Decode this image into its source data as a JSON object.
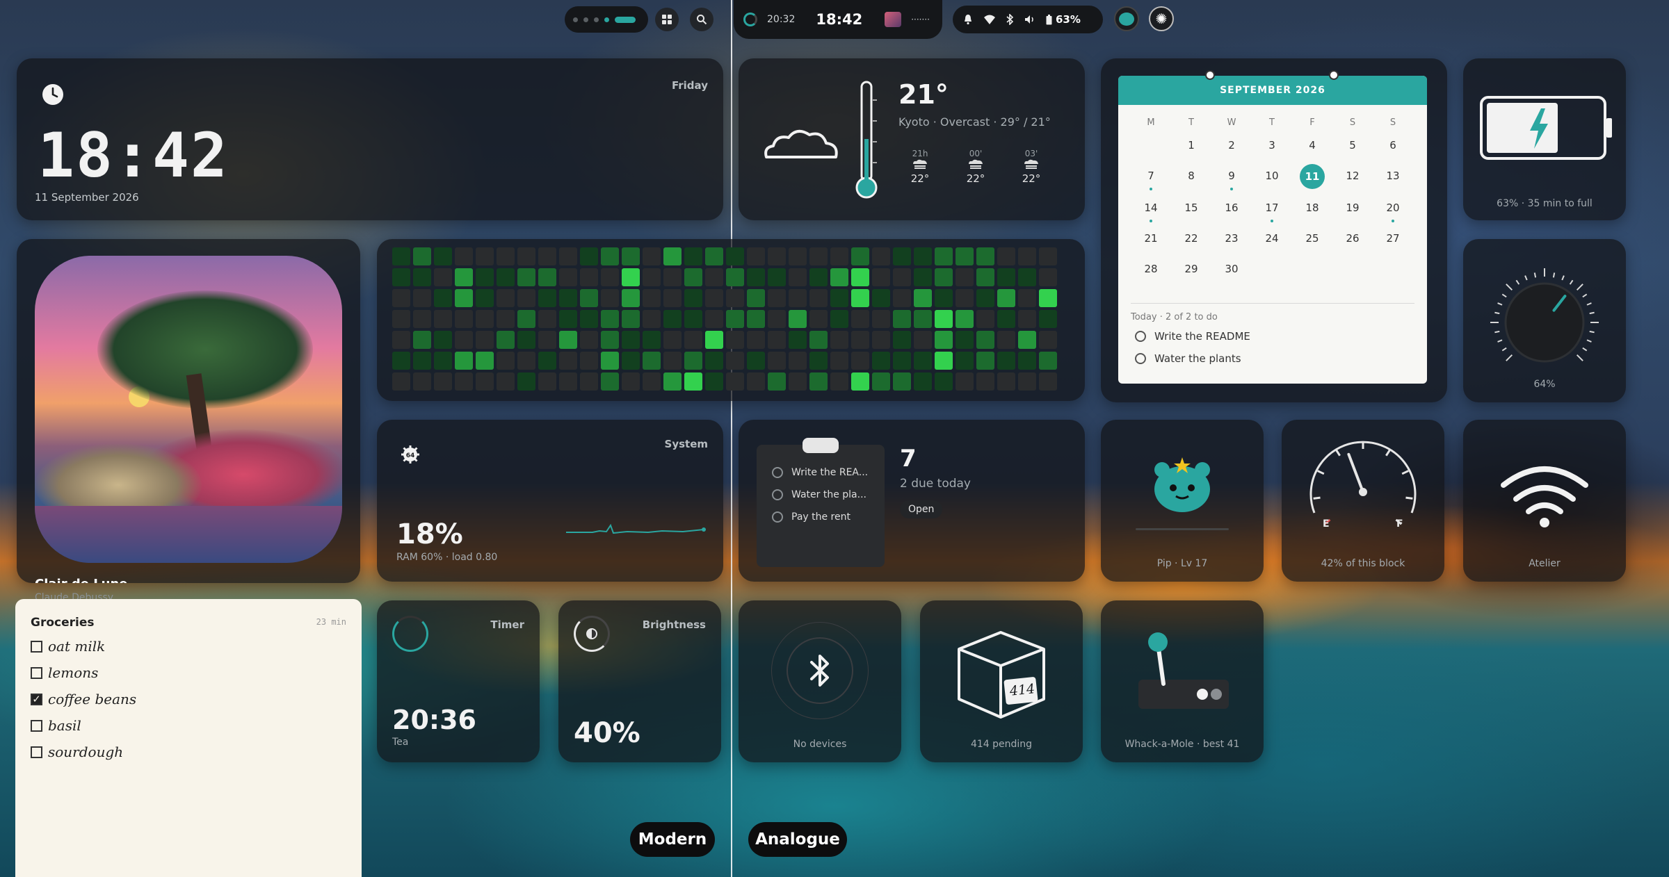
{
  "top_left_bar": {
    "icons": [
      "apps-grid-icon",
      "search-icon"
    ]
  },
  "top_center": {
    "spinner_time": "20:32",
    "clock": "18:42",
    "media_dots": "·······"
  },
  "status_bar": {
    "battery": "63%",
    "icons": [
      "bell-icon",
      "wifi-icon",
      "bluetooth-icon",
      "volume-icon",
      "battery-icon"
    ]
  },
  "clock_card": {
    "day": "Friday",
    "time": "18:42",
    "date": "11 September 2026"
  },
  "weather": {
    "temp": "21°",
    "detail": "Kyoto · Overcast · 29° / 21°",
    "forecast": [
      {
        "time": "21h",
        "temp": "22°"
      },
      {
        "time": "00'",
        "temp": "22°"
      },
      {
        "time": "03'",
        "temp": "22°"
      }
    ]
  },
  "calendar": {
    "month": "SEPTEMBER 2026",
    "weekdays": [
      "M",
      "T",
      "W",
      "T",
      "F",
      "S",
      "S"
    ],
    "today_label": "Today · 2 of 2 to do",
    "todos": [
      "Write the README",
      "Water the plants"
    ]
  },
  "battery_card": {
    "caption": "63% · 35 min to full",
    "level": 0.63
  },
  "dial_card": {
    "caption": "64%",
    "level": 0.64
  },
  "music": {
    "title": "Clair de Lune",
    "artist": "Claude Debussy"
  },
  "groceries": {
    "title": "Groceries",
    "age": "23 min",
    "items": [
      {
        "label": "oat milk",
        "checked": false
      },
      {
        "label": "lemons",
        "checked": false
      },
      {
        "label": "coffee beans",
        "checked": true
      },
      {
        "label": "basil",
        "checked": false
      },
      {
        "label": "sourdough",
        "checked": false
      }
    ]
  },
  "system": {
    "label": "System",
    "cpu": "18%",
    "detail": "RAM 60% · load 0.80"
  },
  "tasks": {
    "items": [
      "Write the REA...",
      "Water the pla...",
      "Pay the rent"
    ],
    "count": "7",
    "due": "2 due today",
    "open_label": "Open"
  },
  "pet": {
    "caption": "Pip · Lv 17"
  },
  "fuel": {
    "caption": "42% of this block",
    "level": 0.42,
    "empty_label": "E",
    "full_label": "F"
  },
  "wifi_card": {
    "caption": "Atelier"
  },
  "timer": {
    "label": "Timer",
    "time": "20:36",
    "name": "Tea"
  },
  "brightness": {
    "label": "Brightness",
    "value": "40%"
  },
  "bluetooth": {
    "caption": "No devices"
  },
  "packages": {
    "badge": "414",
    "caption": "414 pending"
  },
  "game": {
    "caption": "Whack-a-Mole · best 41"
  },
  "modes": {
    "modern": "Modern",
    "analogue": "Analogue"
  },
  "colors": {
    "accent": "#2aa6a0",
    "heat_levels": [
      "#2a2c2e",
      "#12401f",
      "#1c6b2e",
      "#25973c",
      "#33d14e"
    ]
  }
}
